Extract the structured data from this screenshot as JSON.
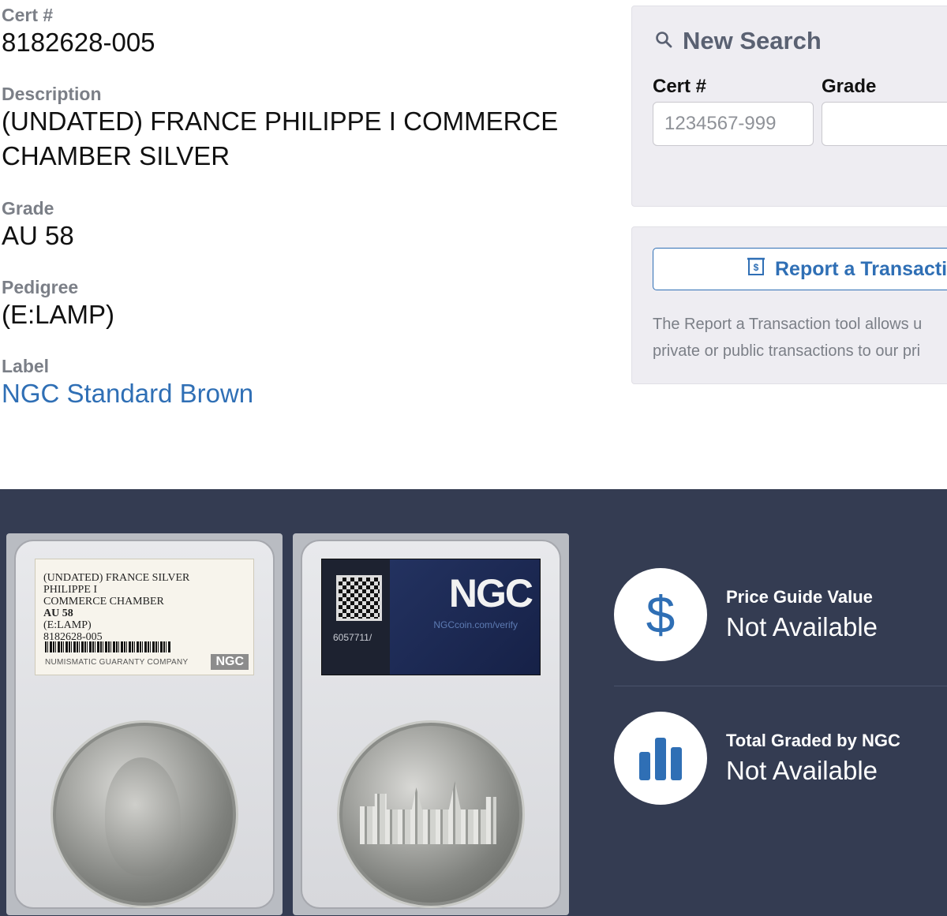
{
  "details": {
    "cert_label": "Cert #",
    "cert_value": "8182628-005",
    "description_label": "Description",
    "description_line1": "(UNDATED) FRANCE PHILIPPE I COMMERCE",
    "description_line2": "CHAMBER SILVER",
    "grade_label": "Grade",
    "grade_value": "AU 58",
    "pedigree_label": "Pedigree",
    "pedigree_value": "(E:LAMP)",
    "label_label": "Label",
    "label_value": "NGC Standard Brown"
  },
  "search": {
    "title": "New Search",
    "icon": "search-icon",
    "cert_label": "Cert #",
    "cert_placeholder": "1234567-999",
    "grade_label": "Grade",
    "grade_value": ""
  },
  "report": {
    "button_label": "Report a Transacti",
    "icon": "receipt-dollar-icon",
    "desc_line1": "The Report a Transaction tool allows u",
    "desc_line2": "private or public transactions to our pri"
  },
  "slab_label": {
    "line1": "(UNDATED) FRANCE SILVER",
    "line2": "PHILIPPE I",
    "line3": "COMMERCE CHAMBER",
    "line4": "AU 58",
    "line5": "(E:LAMP)",
    "line6": "8182628-005",
    "company": "NUMISMATIC GUARANTY COMPANY",
    "logo": "NGC"
  },
  "slab_back": {
    "serial": "6057711/",
    "logo": "NGC",
    "verify": "NGCcoin.com/verify"
  },
  "stats": [
    {
      "title": "Price Guide Value",
      "value": "Not Available",
      "icon": "dollar-icon"
    },
    {
      "title": "Total Graded by NGC",
      "value": "Not Available",
      "icon": "bar-chart-icon"
    }
  ],
  "colors": {
    "accent_blue": "#2f6fb5",
    "band_background": "#343c52",
    "label_gray": "#7b7f87"
  }
}
